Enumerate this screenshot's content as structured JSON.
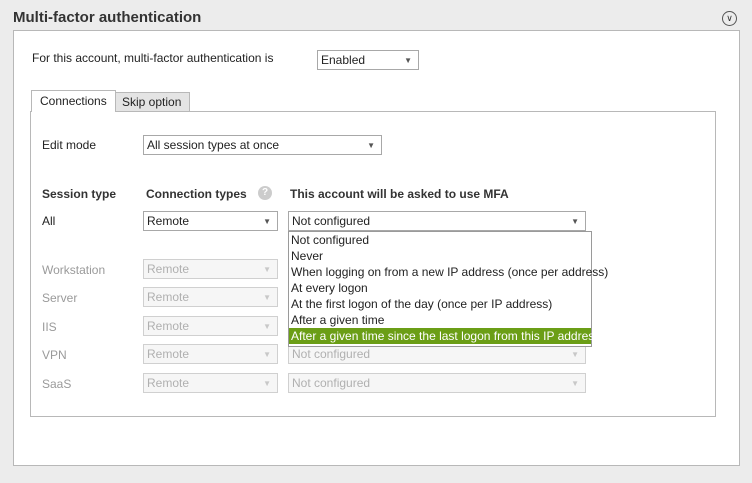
{
  "title": "Multi-factor authentication",
  "mfa_label": "For this account, multi-factor authentication is",
  "mfa_value": "Enabled",
  "tabs": [
    {
      "label": "Connections",
      "active": true
    },
    {
      "label": "Skip option",
      "active": false
    }
  ],
  "edit_mode": {
    "label": "Edit mode",
    "value": "All session types at once"
  },
  "headers": {
    "session_type": "Session type",
    "connection_types": "Connection types",
    "mfa": "This account will be asked to use MFA"
  },
  "rows": [
    {
      "session": "All",
      "connection": "Remote",
      "mfa": "Not configured",
      "enabled": true
    },
    {
      "session": "Workstation",
      "connection": "Remote",
      "mfa": "",
      "enabled": false
    },
    {
      "session": "Server",
      "connection": "Remote",
      "mfa": "",
      "enabled": false
    },
    {
      "session": "IIS",
      "connection": "Remote",
      "mfa": "",
      "enabled": false
    },
    {
      "session": "VPN",
      "connection": "Remote",
      "mfa": "Not configured",
      "enabled": false
    },
    {
      "session": "SaaS",
      "connection": "Remote",
      "mfa": "Not configured",
      "enabled": false
    }
  ],
  "dropdown_options": [
    "Not configured",
    "Never",
    "When logging on from a new IP address (once per address)",
    "At every logon",
    "At the first logon of the day (once per IP address)",
    "After a given time",
    "After a given time since the last logon from this IP address"
  ],
  "highlighted_option": "After a given time since the last logon from this IP address",
  "colors": {
    "highlight": "#6b9e16"
  }
}
